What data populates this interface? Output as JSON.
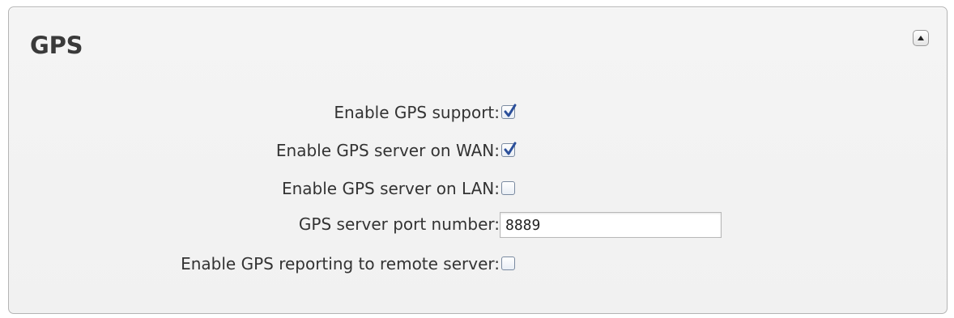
{
  "panel": {
    "title": "GPS",
    "collapse_icon": "triangle-up-icon"
  },
  "settings": [
    {
      "label": "Enable GPS support:",
      "type": "checkbox",
      "checked": true
    },
    {
      "label": "Enable GPS server on WAN:",
      "type": "checkbox",
      "checked": true
    },
    {
      "label": "Enable GPS server on LAN:",
      "type": "checkbox",
      "checked": false
    },
    {
      "label": "GPS server port number:",
      "type": "text",
      "value": "8889"
    },
    {
      "label": "Enable GPS reporting to remote server:",
      "type": "checkbox",
      "checked": false
    }
  ],
  "colors": {
    "check_mark": "#2b4f9a",
    "title_text": "#3a3a3a",
    "label_text": "#333333"
  }
}
